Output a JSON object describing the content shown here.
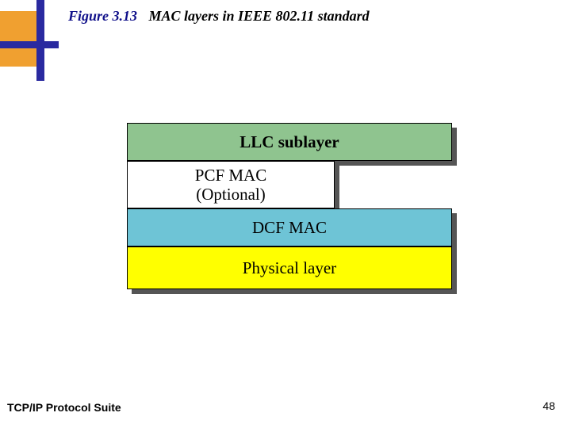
{
  "title": {
    "figure_number": "Figure 3.13",
    "figure_text": "MAC layers in IEEE 802.11 standard"
  },
  "layers": {
    "llc": "LLC sublayer",
    "pcf_line1": "PCF MAC",
    "pcf_line2": "(Optional)",
    "dcf": "DCF MAC",
    "physical": "Physical layer"
  },
  "footer": {
    "left": "TCP/IP Protocol Suite",
    "page": "48"
  },
  "colors": {
    "llc_bg": "#8fc48f",
    "dcf_bg": "#6ec4d6",
    "phy_bg": "#ffff00",
    "accent_blue": "#2a2aa0",
    "accent_orange": "#f0a030"
  }
}
